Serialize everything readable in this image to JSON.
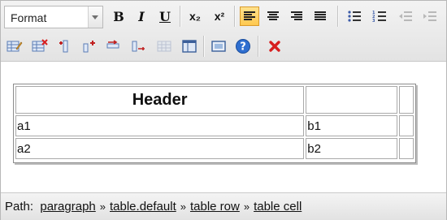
{
  "toolbar": {
    "format_select": {
      "value": "Format"
    },
    "row1_buttons": [
      {
        "name": "bold-button",
        "icon": "bold-icon",
        "glyph": "B"
      },
      {
        "name": "italic-button",
        "icon": "italic-icon",
        "glyph": "I"
      },
      {
        "name": "underline-button",
        "icon": "underline-icon",
        "glyph": "U"
      },
      {
        "name": "subscript-button",
        "icon": "subscript-icon",
        "glyph": "x₂"
      },
      {
        "name": "superscript-button",
        "icon": "superscript-icon",
        "glyph": "x²"
      },
      {
        "name": "align-left-button",
        "icon": "align-left-icon",
        "active": true
      },
      {
        "name": "align-center-button",
        "icon": "align-center-icon"
      },
      {
        "name": "align-right-button",
        "icon": "align-right-icon"
      },
      {
        "name": "align-justify-button",
        "icon": "align-justify-icon"
      },
      {
        "name": "bullet-list-button",
        "icon": "bullet-list-icon"
      },
      {
        "name": "numbered-list-button",
        "icon": "numbered-list-icon"
      },
      {
        "name": "outdent-button",
        "icon": "outdent-icon",
        "disabled": true
      },
      {
        "name": "indent-button",
        "icon": "indent-icon",
        "disabled": true
      }
    ],
    "row2_buttons": [
      {
        "name": "table-properties-button",
        "icon": "table-edit-icon"
      },
      {
        "name": "delete-table-button",
        "icon": "table-delete-icon"
      },
      {
        "name": "insert-column-before-button",
        "icon": "column-insert-before-icon"
      },
      {
        "name": "insert-column-after-button",
        "icon": "column-insert-after-icon"
      },
      {
        "name": "insert-row-before-button",
        "icon": "row-insert-before-icon"
      },
      {
        "name": "insert-row-after-button",
        "icon": "row-insert-after-icon"
      },
      {
        "name": "merge-cells-button",
        "icon": "merge-cells-icon",
        "disabled": true
      },
      {
        "name": "split-cells-button",
        "icon": "split-cells-icon"
      },
      {
        "name": "show-blocks-button",
        "icon": "window-icon"
      },
      {
        "name": "help-button",
        "icon": "help-icon"
      },
      {
        "name": "remove-format-button",
        "icon": "close-icon"
      }
    ]
  },
  "table": {
    "header": [
      "Header",
      "",
      ""
    ],
    "rows": [
      [
        "a1",
        "b1",
        ""
      ],
      [
        "a2",
        "b2",
        ""
      ]
    ]
  },
  "status": {
    "path_label": "Path:",
    "path": [
      "paragraph",
      "table.default",
      "table row",
      "table cell"
    ],
    "separator": "»"
  },
  "colors": {
    "active_button": "#ffc84f",
    "delete_red": "#d71e1e",
    "help_blue": "#2f6fd0"
  }
}
